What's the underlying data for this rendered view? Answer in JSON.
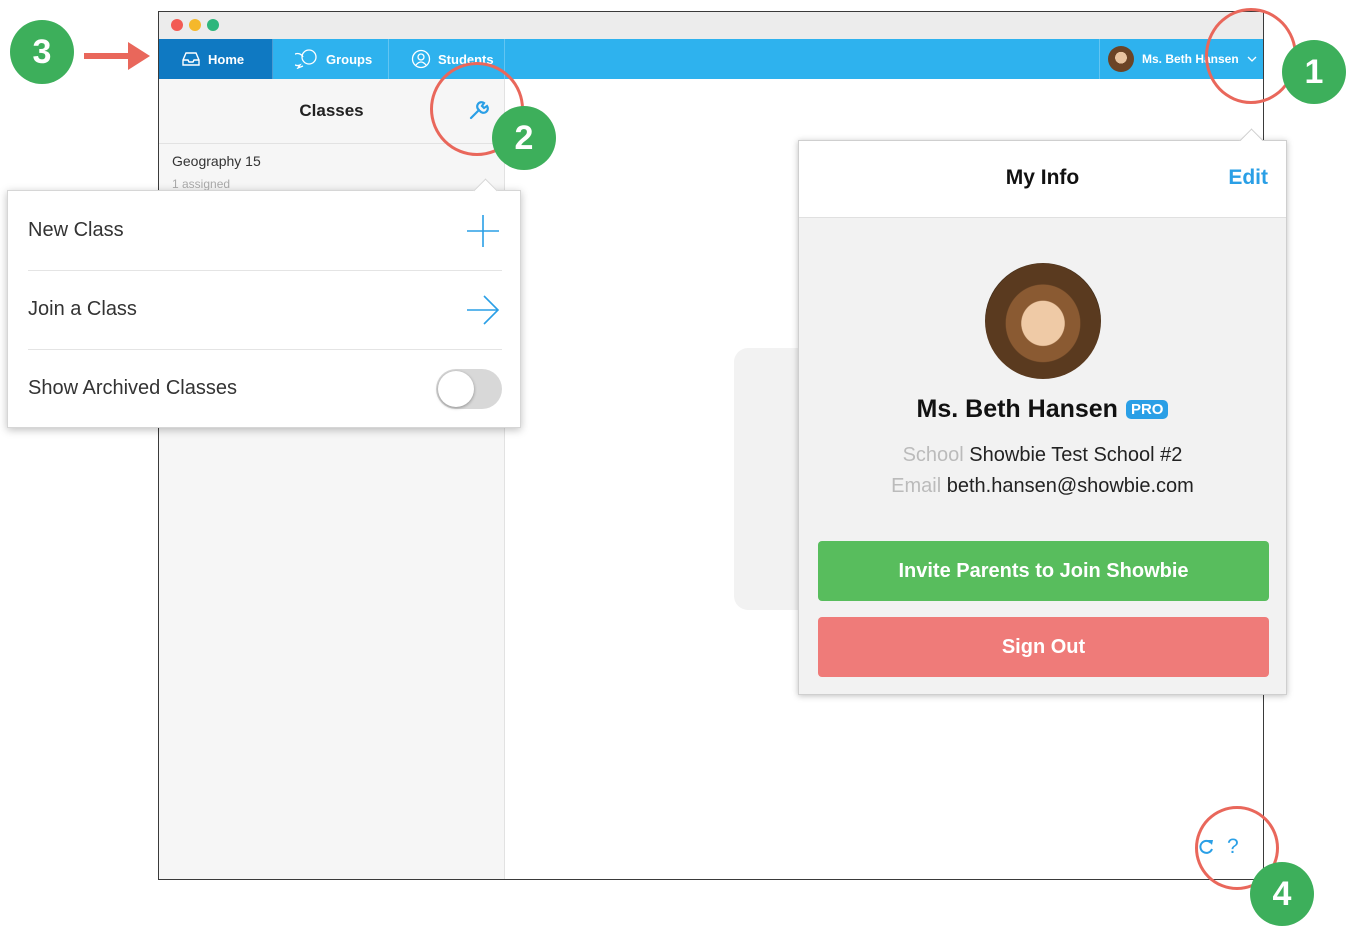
{
  "nav": {
    "tabs": [
      {
        "label": "Home",
        "icon": "inbox-icon"
      },
      {
        "label": "Groups",
        "icon": "chat-bubbles-icon"
      },
      {
        "label": "Students",
        "icon": "person-icon"
      }
    ],
    "user_label": "Ms. Beth Hansen"
  },
  "sidebar": {
    "title": "Classes",
    "class_item": {
      "name": "Geography 15",
      "sub": "1 assigned"
    }
  },
  "class_menu": {
    "new_class": "New Class",
    "join_class": "Join a Class",
    "show_archived": "Show Archived Classes",
    "show_archived_on": false
  },
  "info": {
    "title": "My Info",
    "edit": "Edit",
    "name": "Ms. Beth Hansen",
    "badge": "PRO",
    "school_label": "School",
    "school": "Showbie Test School #2",
    "email_label": "Email",
    "email": "beth.hansen@showbie.com",
    "invite_button": "Invite Parents to Join Showbie",
    "signout_button": "Sign Out"
  },
  "help": "?",
  "annotations": {
    "marker_1": "1",
    "marker_2": "2",
    "marker_3": "3",
    "marker_4": "4"
  },
  "colors": {
    "nav_blue": "#2eb2ee",
    "nav_active": "#0f79c2",
    "accent_blue": "#2a9fe6",
    "invite_green": "#58bd5d",
    "signout_red": "#ef7b79",
    "annotation_red": "#e9675b",
    "annotation_green": "#3daf5b"
  }
}
